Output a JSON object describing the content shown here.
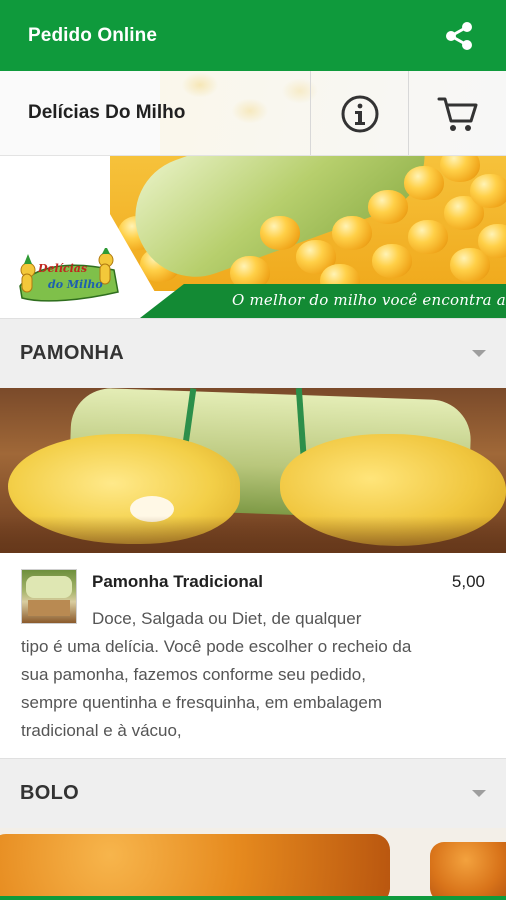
{
  "appbar": {
    "title": "Pedido Online",
    "share_icon": "share-icon",
    "color": "#0f9a3c"
  },
  "store": {
    "name": "Delícias Do Milho",
    "info_icon": "info-icon",
    "cart_icon": "cart-icon"
  },
  "banner": {
    "logo_text_line1": "Delícias",
    "logo_text_line2": "do Milho",
    "slogan": "O melhor do milho você encontra aqui"
  },
  "sections": [
    {
      "title": "PAMONHA",
      "products": [
        {
          "name": "Pamonha Tradicional",
          "price": "5,00",
          "description_line1": "Doce, Salgada ou Diet, de qualquer",
          "description_rest": "tipo é uma delícia. Você pode escolher o recheio da sua pamonha, fazemos conforme seu pedido, sempre quentinha e fresquinha, em embalagem tradicional e à vácuo,"
        }
      ]
    },
    {
      "title": "BOLO",
      "products": []
    }
  ]
}
